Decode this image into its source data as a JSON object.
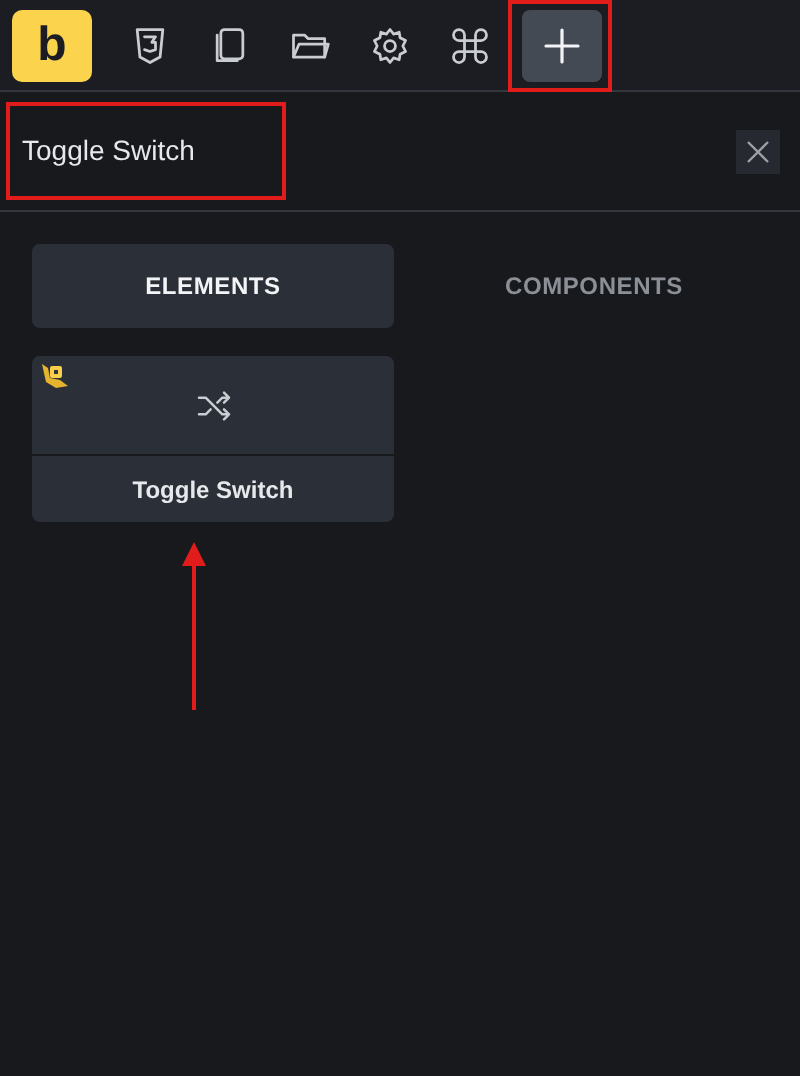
{
  "toolbar": {
    "logo": "b",
    "items": [
      {
        "kind": "css3",
        "selected": false,
        "highlighted": false
      },
      {
        "kind": "pages",
        "selected": false,
        "highlighted": false
      },
      {
        "kind": "folder",
        "selected": false,
        "highlighted": false
      },
      {
        "kind": "settings",
        "selected": false,
        "highlighted": false
      },
      {
        "kind": "command",
        "selected": false,
        "highlighted": false
      },
      {
        "kind": "add",
        "selected": true,
        "highlighted": true
      }
    ]
  },
  "search": {
    "value": "Toggle Switch",
    "highlighted": true
  },
  "tabs": [
    {
      "label": "ELEMENTS",
      "selected": true
    },
    {
      "label": "COMPONENTS",
      "selected": false
    }
  ],
  "elements": [
    {
      "label": "Toggle Switch",
      "kind": "shuffle",
      "badge": true,
      "pointed_at": true
    }
  ]
}
